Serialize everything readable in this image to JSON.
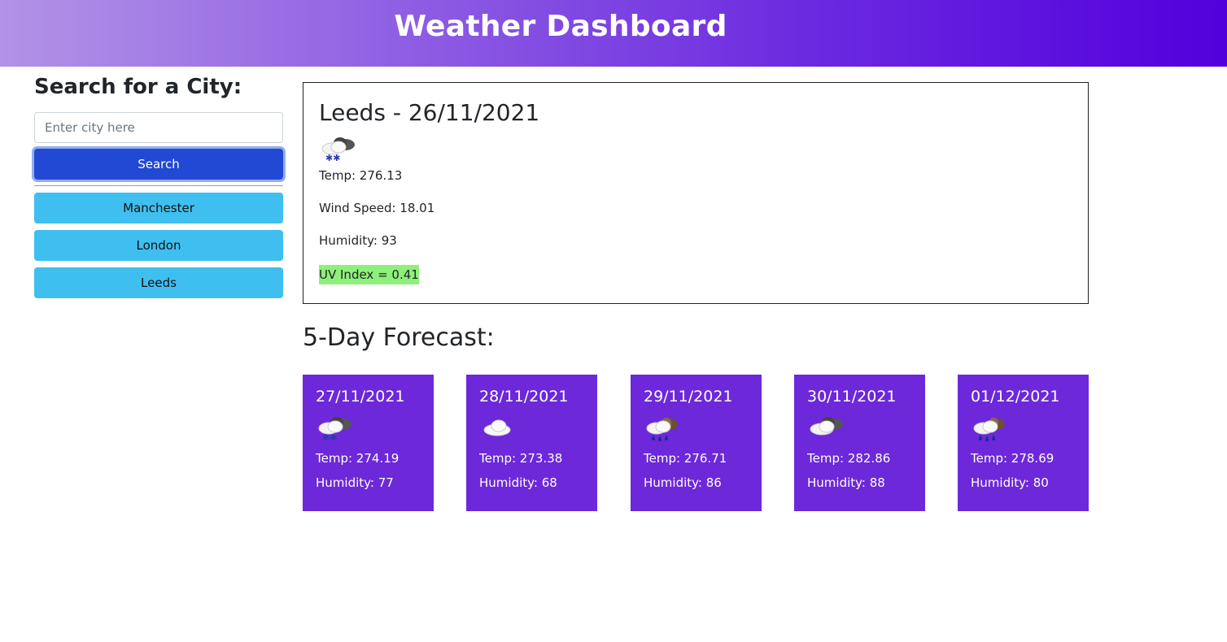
{
  "header": {
    "title": "Weather Dashboard"
  },
  "sidebar": {
    "heading": "Search for a City:",
    "search_placeholder": "Enter city here",
    "search_label": "Search",
    "history": [
      "Manchester",
      "London",
      "Leeds"
    ]
  },
  "current": {
    "title": "Leeds - 26/11/2021",
    "icon": "snow-cloud-icon",
    "temp": "Temp: 276.13",
    "wind": "Wind Speed: 18.01",
    "humidity": "Humidity: 93",
    "uv": "UV Index = 0.41",
    "uv_color": "#8ef07a"
  },
  "forecast": {
    "heading": "5-Day Forecast:",
    "card_color": "#6d28d9",
    "days": [
      {
        "date": "27/11/2021",
        "icon": "snow-cloud-icon",
        "temp": "Temp: 274.19",
        "humidity": "Humidity: 77"
      },
      {
        "date": "28/11/2021",
        "icon": "cloud-icon",
        "temp": "Temp: 273.38",
        "humidity": "Humidity: 68"
      },
      {
        "date": "29/11/2021",
        "icon": "rain-cloud-icon",
        "temp": "Temp: 276.71",
        "humidity": "Humidity: 86"
      },
      {
        "date": "30/11/2021",
        "icon": "broken-clouds-icon",
        "temp": "Temp: 282.86",
        "humidity": "Humidity: 88"
      },
      {
        "date": "01/12/2021",
        "icon": "rain-cloud-icon",
        "temp": "Temp: 278.69",
        "humidity": "Humidity: 80"
      }
    ]
  }
}
